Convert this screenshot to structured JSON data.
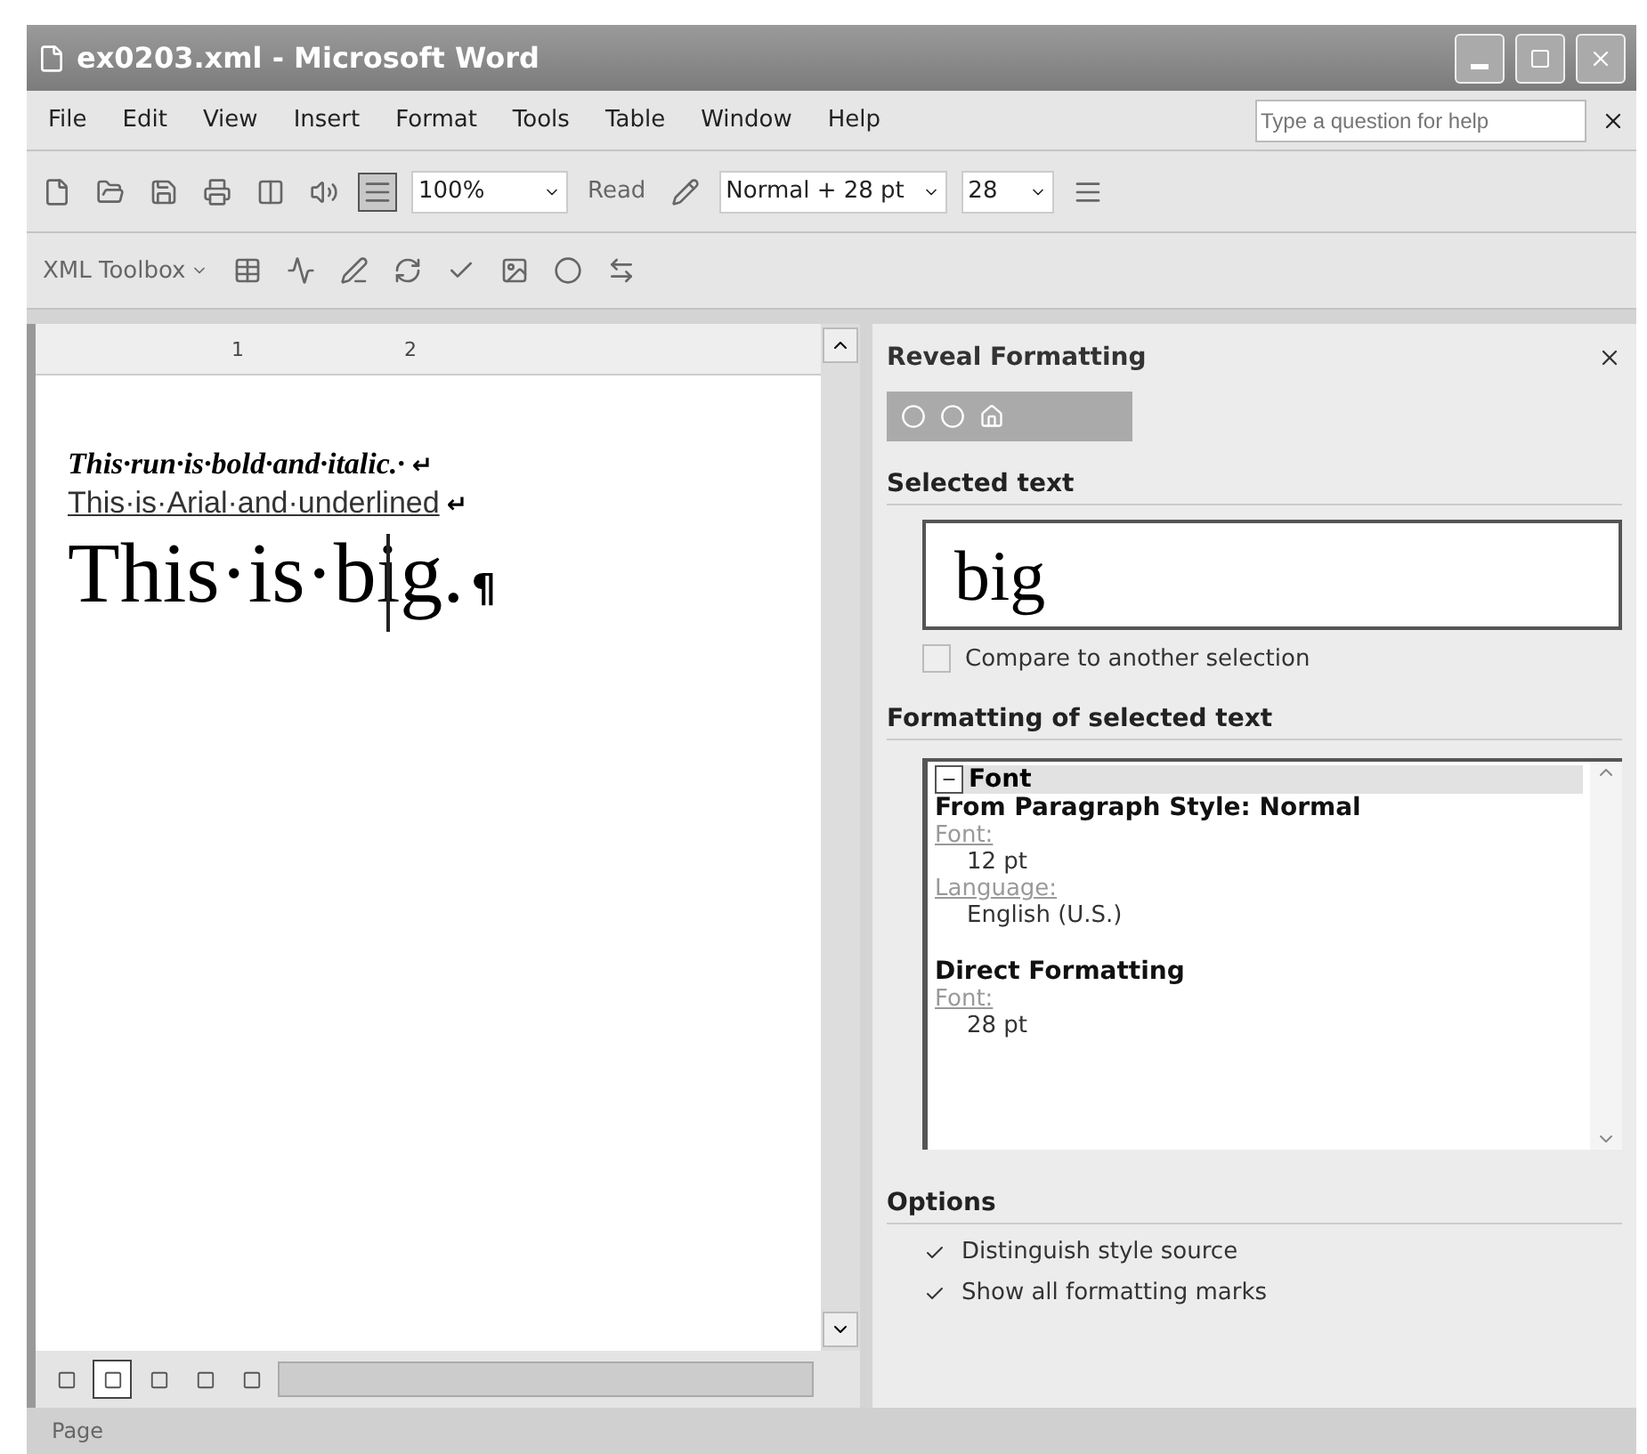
{
  "window": {
    "title": "ex0203.xml - Microsoft Word"
  },
  "menu": {
    "items": [
      {
        "label": "File"
      },
      {
        "label": "Edit"
      },
      {
        "label": "View"
      },
      {
        "label": "Insert"
      },
      {
        "label": "Format"
      },
      {
        "label": "Tools"
      },
      {
        "label": "Table"
      },
      {
        "label": "Window"
      },
      {
        "label": "Help"
      }
    ],
    "help_placeholder": "Type a question for help"
  },
  "standard_toolbar": {
    "show_marks_on": true,
    "zoom": "100%",
    "read": "Read"
  },
  "formatting_toolbar": {
    "style": "Normal + 28 pt",
    "size": "28"
  },
  "xml_toolbar": {
    "label": "XML Toolbox"
  },
  "ruler": {
    "marks": [
      "1",
      "2"
    ]
  },
  "document": {
    "paragraphs": [
      {
        "kind": "bold_italic",
        "text": "This·run·is·bold·and·italic.·",
        "end_mark": "↵"
      },
      {
        "kind": "arial_underlined",
        "text": "This·is·Arial·and·underlined",
        "end_mark": "↵"
      },
      {
        "kind": "big",
        "text": "This·is·big.",
        "end_mark": "¶"
      }
    ]
  },
  "view_buttons": [
    {
      "selected": false
    },
    {
      "selected": true
    },
    {
      "selected": false
    },
    {
      "selected": false
    },
    {
      "selected": false
    }
  ],
  "task_pane": {
    "title": "Reveal Formatting",
    "selected_heading": "Selected text",
    "preview": "big",
    "compare": {
      "label": "Compare to another selection",
      "checked": false
    },
    "formatting_heading": "Formatting of selected text",
    "group": {
      "label": "Font",
      "expanded": true,
      "entries": [
        {
          "kind": "heading",
          "text": "From Paragraph Style: Normal"
        },
        {
          "kind": "link",
          "text": "Font:"
        },
        {
          "kind": "value",
          "text": "12 pt"
        },
        {
          "kind": "link",
          "text": "Language:"
        },
        {
          "kind": "value",
          "text": "English (U.S.)"
        },
        {
          "kind": "spacer"
        },
        {
          "kind": "heading",
          "text": "Direct Formatting"
        },
        {
          "kind": "link",
          "text": "Font:"
        },
        {
          "kind": "value",
          "text": "28 pt"
        }
      ]
    },
    "options_heading": "Options",
    "options": [
      {
        "label": "Distinguish style source",
        "checked": true
      },
      {
        "label": "Show all formatting marks",
        "checked": true
      }
    ]
  },
  "status_bar": {
    "page": "Page"
  }
}
